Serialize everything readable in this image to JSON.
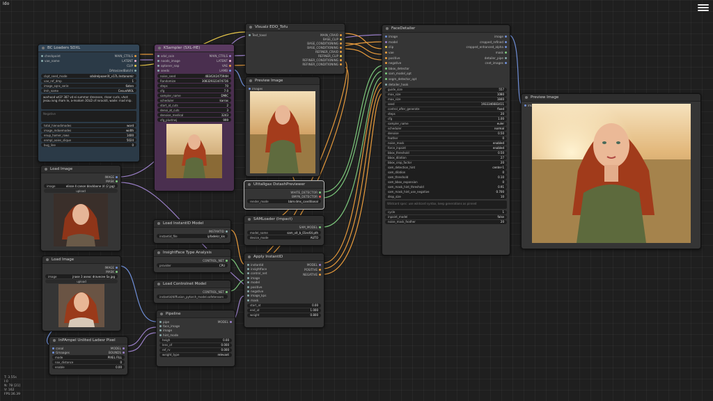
{
  "app": {
    "title": "Ido"
  },
  "stats": [
    "T: 3.55s",
    "I:0",
    "N: 78 [21]",
    "V: 162",
    "FPS:36.39"
  ],
  "colors": {
    "canvas": "#1f1f1f",
    "node": "#353535",
    "wire_orange": "#e89b3c",
    "wire_purple": "#9a7fc8",
    "wire_blue": "#6f8fd8",
    "wire_green": "#7cc87c"
  },
  "nodes": {
    "lora": {
      "title": "BC Loaders SDXL",
      "inputs": [
        "checkpoint",
        "vae_name"
      ],
      "outputs": [
        "MAIN_CTRLS",
        "LATENT",
        "CLIP",
        "DAtosizedBatchl"
      ],
      "widgets": [
        {
          "k": "ckpt_seed_mode",
          "v": "sdxlrelpoaeriX_v17L.Instanomir"
        },
        {
          "k": "vae_ref_dmp",
          "v": "1"
        },
        {
          "k": "image_sqns_serie",
          "v": "6aten"
        },
        {
          "k": "Imh_name",
          "v": "CesunlW0L"
        }
      ],
      "prompt": "warhood wt3? 387 vd ei summer dresnsen, rlsser curls, vhot: jesau ivng rham le, a-modom 3OLD of roracktl, wade: rnad mip.",
      "negative_placeholder": "Negative",
      "widgets2": [
        {
          "k": "total_hienodimodes",
          "v": "word"
        },
        {
          "k": "image_mdoemodes",
          "v": "width"
        },
        {
          "k": "enup_homer_rows",
          "v": "1400"
        },
        {
          "k": "enmpl_ooies_slique",
          "v": "5024"
        },
        {
          "k": "bug_line",
          "v": "0"
        }
      ]
    },
    "ksampler": {
      "title": "KSampler (SXL-HE)",
      "inputs": [
        "sdxl_coin",
        "noods_image",
        "optoner_nap",
        "seeds"
      ],
      "outputs": [
        "MAIN_CTRLS",
        "LATENT",
        "VAE",
        "LAMB"
      ],
      "seed": {
        "k": "noise_seed",
        "v": "483424247594H"
      },
      "seed_mode": {
        "a": "Randomize",
        "b": "308329323474736"
      },
      "widgets": [
        {
          "k": "steps",
          "v": "70"
        },
        {
          "k": "cfg",
          "v": "7.0"
        },
        {
          "k": "sampler_name",
          "v": "DMIC"
        },
        {
          "k": "scheduler",
          "v": "karras"
        },
        {
          "k": "start_at_cuts",
          "v": "2"
        },
        {
          "k": "denoi_at_cuts",
          "v": "3"
        },
        {
          "k": "denoise_medical",
          "v": "3243"
        },
        {
          "k": "cfg_plustrwj",
          "v": "999"
        }
      ]
    },
    "clip": {
      "title": "Vlsualz EDO_Tofu",
      "inputs": [
        "Text_toxol"
      ],
      "outputs": [
        "MAIN_CRAIO",
        "BASE_CLIP",
        "BASE_CONDITIONING",
        "BASE_CONDITIONING",
        "REFINER_CRAIO",
        "REFINER_CLIP",
        "REFINER_CONDITIONING",
        "REFINER_CONDITIONING"
      ]
    },
    "preview1": {
      "title": "Preview Image",
      "inputs": [
        "images"
      ]
    },
    "facedetailer": {
      "title": "FaceDetailer",
      "inputs": [
        "image",
        "model",
        "clip",
        "vae",
        "positive",
        "negative",
        "bbox_detector",
        "sam_model_opt",
        "segm_detector_opt",
        "detailer_hook"
      ],
      "outputs": [
        "image",
        "cropped_refined",
        "cropped_enhanced_alpha",
        "mask",
        "detailer_pipe",
        "cnet_images"
      ],
      "widgets": [
        {
          "k": "guide_size",
          "v": "557"
        },
        {
          "k": "max_size",
          "v": "1080"
        },
        {
          "k": "max_size",
          "v": "1840"
        },
        {
          "k": "seed",
          "v": "1933346683411"
        },
        {
          "k": "control_after_generate",
          "v": "fixed"
        },
        {
          "k": "steps",
          "v": "20"
        },
        {
          "k": "cfg",
          "v": "1.00"
        },
        {
          "k": "sampler_name",
          "v": "euler"
        },
        {
          "k": "scheduler",
          "v": "normal"
        },
        {
          "k": "denoise",
          "v": "0.50"
        },
        {
          "k": "feather",
          "v": "0"
        },
        {
          "k": "noise_mask",
          "v": "enabled"
        },
        {
          "k": "force_inpaint",
          "v": "enabled"
        },
        {
          "k": "bbox_threshold",
          "v": "0.50"
        },
        {
          "k": "bbox_dilation",
          "v": "27"
        },
        {
          "k": "bbox_crop_factor",
          "v": "20"
        },
        {
          "k": "sam_detection_hint",
          "v": "center-1"
        },
        {
          "k": "sam_dilation",
          "v": "0"
        },
        {
          "k": "sam_threshold",
          "v": "0.10"
        },
        {
          "k": "sam_bbox_expansion",
          "v": "0"
        },
        {
          "k": "sam_mask_hint_threshold",
          "v": "0.91"
        },
        {
          "k": "sam_mask_hint_use_negative",
          "v": "0.700"
        },
        {
          "k": "drop_size",
          "v": "10"
        }
      ],
      "wildcard_placeholder": "Wildcard spec: use wildcard syntax, keep generations as pinned",
      "widgets2": [
        {
          "k": "cycle",
          "v": "1"
        },
        {
          "k": "inpaint_model",
          "v": "false"
        },
        {
          "k": "noise_mask_feather",
          "v": "20"
        }
      ]
    },
    "preview2": {
      "title": "Preview Image",
      "inputs": [
        "images"
      ]
    },
    "depth": {
      "title": "Ulttallgax DstashPreviewer",
      "outputs": [
        "WHITE_DETECTOR",
        "BMYN_DETECTOR"
      ],
      "widgets": [
        {
          "k": "render_mode",
          "v": "bbm:dms_canditional"
        }
      ]
    },
    "samloader": {
      "title": "SAMLoader (Impact)",
      "outputs": [
        "SAM_MODEL"
      ],
      "widgets": [
        {
          "k": "model_name",
          "v": "sam_vit_b_01ec64.pth"
        },
        {
          "k": "device_mode",
          "v": "AUTO"
        }
      ]
    },
    "apply": {
      "title": "Apply InstantID",
      "inputs": [
        "instantid",
        "insightface",
        "control_net",
        "image",
        "model",
        "positive",
        "negative",
        "image_kps",
        "mask"
      ],
      "outputs": [
        "MODEL",
        "POSITIVE",
        "NEGATIVE"
      ],
      "widgets": [
        {
          "k": "start_at",
          "v": "0.00"
        },
        {
          "k": "end_at",
          "v": "1.000"
        },
        {
          "k": "weight",
          "v": "0.800"
        }
      ]
    },
    "loadimage1": {
      "title": "Load Image",
      "outputs": [
        "IMAGE",
        "MASK"
      ],
      "widgets": [
        {
          "k": "image",
          "v": "elisse 4 canon blackbone (4 (2 jpg)"
        }
      ],
      "button": "upload"
    },
    "loadimage2": {
      "title": "Load Image",
      "outputs": [
        "IMAGE",
        "MASK"
      ],
      "widgets": [
        {
          "k": "image",
          "v": "jnase 3 aseoc dravecee Sx.jpg"
        }
      ],
      "button": "upload"
    },
    "instantloader": {
      "title": "Load InstantID Model",
      "outputs": [
        "INSTANTID"
      ],
      "widgets": [
        {
          "k": "instantid_file",
          "v": "ipfadelcr_kis"
        }
      ]
    },
    "insightface": {
      "title": "InsightFace Type Analysis",
      "outputs": [
        "CONTROL_NET"
      ],
      "widgets": [
        {
          "k": "provider",
          "v": "CPU"
        }
      ]
    },
    "controlnet": {
      "title": "Load Controlnet Model",
      "outputs": [
        "CONTROL_NET"
      ],
      "widgets": [
        {
          "k": "control_net_name",
          "v": "instantid/diffusion_pytorch_model.safetensors"
        }
      ]
    },
    "upscale": {
      "title": "InPAmpel Unlited Ladesr Pixel",
      "inputs": [
        "canal",
        "Gmaages"
      ],
      "outputs": [
        "MODEL",
        "BOUNDS"
      ],
      "widgets": [
        {
          "k": "mode",
          "v": "PIXEL FILL"
        },
        {
          "k": "nax_distance",
          "v": "0"
        },
        {
          "k": "enable",
          "v": "0.00"
        }
      ]
    },
    "pipeline": {
      "title": "Pipeline",
      "inputs": [
        "pipe",
        "face_image",
        "image",
        "hint_mode"
      ],
      "outputs": [
        "MODEL"
      ],
      "widgets": [
        {
          "k": "heigh",
          "v": "0.00"
        },
        {
          "k": "lens_of",
          "v": "0.000"
        },
        {
          "k": "ref_rv",
          "v": "0.000"
        },
        {
          "k": "weight_type",
          "v": "relevant"
        }
      ]
    }
  }
}
